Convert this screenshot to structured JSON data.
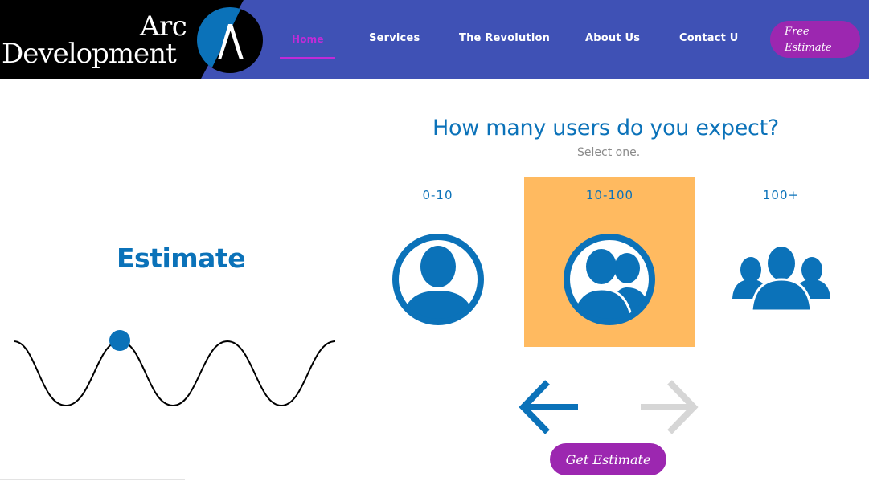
{
  "header": {
    "logo_line1": "Arc",
    "logo_line2": "Development",
    "tabs": [
      {
        "label": "Home"
      },
      {
        "label": "Services"
      },
      {
        "label": "The Revolution"
      },
      {
        "label": "About Us"
      },
      {
        "label": "Contact U"
      }
    ],
    "active_tab": "Home",
    "cta_line1": "Free",
    "cta_line2": "Estimate"
  },
  "left": {
    "title": "Estimate"
  },
  "question": {
    "title": "How many users do you expect?",
    "subtitle": "Select one.",
    "options": [
      {
        "label": "0-10",
        "icon": "person-icon",
        "selected": false
      },
      {
        "label": "10-100",
        "icon": "persons-icon",
        "selected": true
      },
      {
        "label": "100+",
        "icon": "people-group-icon",
        "selected": false
      }
    ]
  },
  "navigation": {
    "back_icon": "arrow-back-icon",
    "forward_icon": "arrow-forward-icon",
    "forward_disabled": true,
    "submit_label": "Get Estimate"
  },
  "colors": {
    "primary": "#3f51b5",
    "blue": "#0b72b9",
    "accent": "#9c27b0",
    "selected_bg": "#ffba60",
    "disabled_arrow": "#d6d6d6"
  }
}
